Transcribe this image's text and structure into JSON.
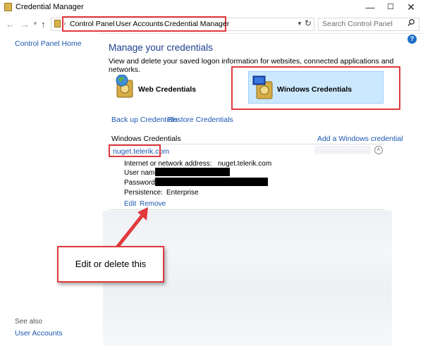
{
  "window": {
    "title": "Credential Manager"
  },
  "address": {
    "crumbs": [
      "Control Panel",
      "User Accounts",
      "Credential Manager"
    ],
    "search_placeholder": "Search Control Panel"
  },
  "left_pane": {
    "home_link": "Control Panel Home",
    "see_also": "See also",
    "user_accounts": "User Accounts"
  },
  "main": {
    "title": "Manage your credentials",
    "description": "View and delete your saved logon information for websites, connected applications and networks.",
    "web_credentials": "Web Credentials",
    "windows_credentials": "Windows Credentials",
    "backup_link": "Back up Credentials",
    "restore_link": "Restore Credentials"
  },
  "windows_section": {
    "header": "Windows Credentials",
    "add_link": "Add a Windows credential",
    "entry_name": "nuget.telerik.com",
    "fields": {
      "address_label": "Internet or network address:",
      "address_value": "nuget.telerik.com",
      "username_label": "User name:",
      "password_label": "Password:",
      "persistence_label": "Persistence:",
      "persistence_value": "Enterprise"
    },
    "edit_link": "Edit",
    "remove_link": "Remove"
  },
  "callout": {
    "text": "Edit or delete this"
  },
  "colors": {
    "accent_red": "#e0393e",
    "link_blue": "#1a56b0",
    "selected_tile": "#cce8ff"
  }
}
